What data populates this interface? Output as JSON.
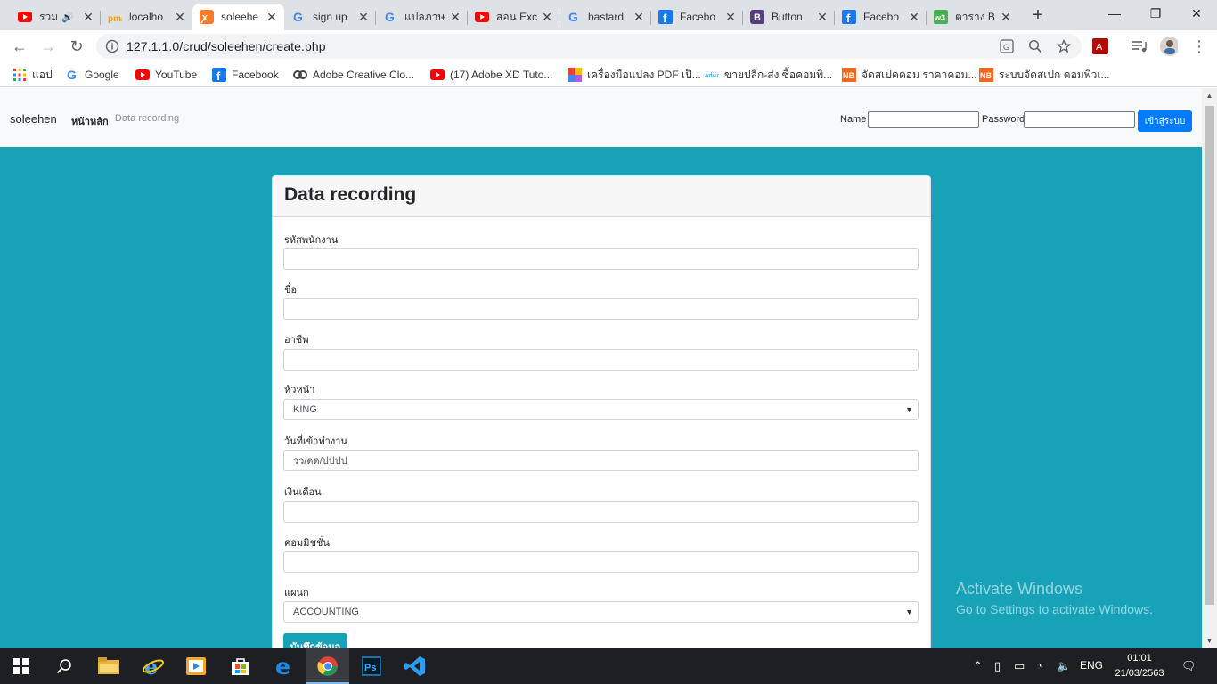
{
  "browser": {
    "tabs": [
      {
        "title": "รวม",
        "favicon": "youtube-icon",
        "audible": true,
        "active": false
      },
      {
        "title": "localho",
        "favicon": "phpmyadmin-icon",
        "active": false
      },
      {
        "title": "soleehe",
        "favicon": "xampp-icon",
        "active": true
      },
      {
        "title": "sign up",
        "favicon": "google-icon",
        "active": false
      },
      {
        "title": "แปลภาษ",
        "favicon": "google-icon",
        "active": false
      },
      {
        "title": "สอน Exc",
        "favicon": "youtube-icon",
        "active": false
      },
      {
        "title": "bastard",
        "favicon": "google-icon",
        "active": false
      },
      {
        "title": "Facebo",
        "favicon": "facebook-icon",
        "active": false
      },
      {
        "title": "Button",
        "favicon": "bootstrap-icon",
        "active": false
      },
      {
        "title": "Facebo",
        "favicon": "facebook-icon",
        "active": false
      },
      {
        "title": "ตาราง B",
        "favicon": "w3schools-icon",
        "active": false
      }
    ],
    "url": "127.1.1.0/crud/soleehen/create.php",
    "bookmarks": [
      {
        "label": "แอป",
        "icon": "apps-grid-icon"
      },
      {
        "label": "Google",
        "icon": "google-icon"
      },
      {
        "label": "YouTube",
        "icon": "youtube-icon"
      },
      {
        "label": "Facebook",
        "icon": "facebook-icon"
      },
      {
        "label": "Adobe Creative Clo...",
        "icon": "adobe-cc-icon"
      },
      {
        "label": "(17) Adobe XD Tuto...",
        "icon": "youtube-icon"
      },
      {
        "label": "เครื่องมือแปลง PDF เป็...",
        "icon": "ilovepdf-icon"
      },
      {
        "label": "ขายปลีก-ส่ง ซื้อคอมพิ...",
        "icon": "advice-icon"
      },
      {
        "label": "จัดสเปคคอม ราคาคอม...",
        "icon": "notebookspec-icon"
      },
      {
        "label": "ระบบจัดสเปก คอมพิวเ...",
        "icon": "notebookspec-icon"
      }
    ]
  },
  "navbar": {
    "brand": "soleehen",
    "home": "หน้าหลัก",
    "link": "Data recording",
    "name_label": "Name",
    "password_label": "Password",
    "login_button": "เข้าสู่ระบบ"
  },
  "form": {
    "title": "Data recording",
    "fields": [
      {
        "label": "รหัสพนักงาน",
        "type": "text",
        "value": ""
      },
      {
        "label": "ชื่อ",
        "type": "text",
        "value": ""
      },
      {
        "label": "อาชีพ",
        "type": "text",
        "value": ""
      },
      {
        "label": "หัวหน้า",
        "type": "select",
        "value": "KING"
      },
      {
        "label": "วันที่เข้าทำงาน",
        "type": "date",
        "value": "วว/ดด/ปปปป"
      },
      {
        "label": "เงินเดือน",
        "type": "text",
        "value": ""
      },
      {
        "label": "คอมมิชชั่น",
        "type": "text",
        "value": ""
      },
      {
        "label": "แผนก",
        "type": "select",
        "value": "ACCOUNTING"
      }
    ],
    "submit": "บันทึกข้อมูล"
  },
  "watermark": {
    "line1": "Activate Windows",
    "line2": "Go to Settings to activate Windows."
  },
  "taskbar": {
    "apps": [
      "file-explorer-icon",
      "internet-explorer-icon",
      "media-player-icon",
      "store-icon",
      "edge-icon",
      "chrome-icon",
      "photoshop-icon",
      "vscode-icon"
    ],
    "language": "ENG",
    "time": "01:01",
    "date": "21/03/2563"
  },
  "colors": {
    "page_bg": "#17a2b8",
    "primary_button": "#007bff",
    "submit_button": "#17a2b8",
    "taskbar": "#1e1f23"
  }
}
